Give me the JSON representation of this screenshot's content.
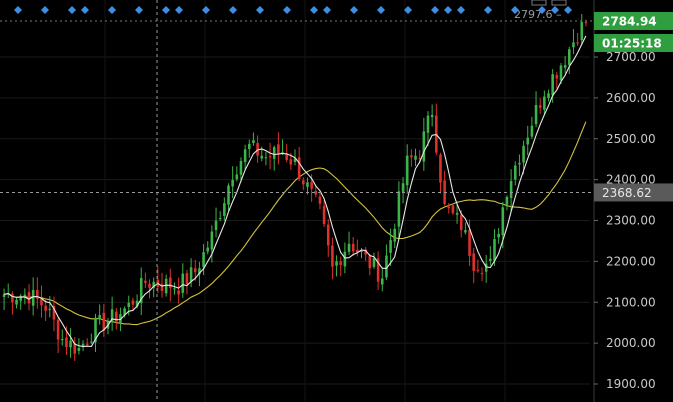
{
  "chart_data": {
    "type": "candlestick",
    "y_axis": {
      "ticks": [
        "1900.00",
        "2000.00",
        "2100.00",
        "2200.00",
        "2300.00",
        "2400.00",
        "2500.00",
        "2600.00",
        "2700.00"
      ],
      "range": [
        1855,
        2830
      ]
    },
    "price_tag": {
      "value": "2784.94",
      "color": "#2e9e3e"
    },
    "timer_tag": {
      "value": "01:25:18",
      "color": "#2e9e3e"
    },
    "cursor_tag": {
      "value": "2368.62",
      "color": "#5a5a5a"
    },
    "ref_line": {
      "label": "2797.6 –",
      "value": 2797.6
    },
    "colors": {
      "up": "#3bb54a",
      "down": "#e0302c",
      "ma_fast": "#e8e8e8",
      "ma_slow": "#d4c23a",
      "marker": "#3d8fe6",
      "grid": "#1a1a1a"
    },
    "candle_count": 141,
    "keypoints": [
      [
        0,
        2120
      ],
      [
        6,
        2118
      ],
      [
        10,
        2090
      ],
      [
        14,
        2010
      ],
      [
        18,
        1985
      ],
      [
        22,
        2040
      ],
      [
        26,
        2060
      ],
      [
        30,
        2090
      ],
      [
        34,
        2150
      ],
      [
        38,
        2145
      ],
      [
        42,
        2140
      ],
      [
        46,
        2175
      ],
      [
        50,
        2260
      ],
      [
        55,
        2420
      ],
      [
        59,
        2480
      ],
      [
        63,
        2455
      ],
      [
        67,
        2470
      ],
      [
        70,
        2440
      ],
      [
        73,
        2380
      ],
      [
        76,
        2320
      ],
      [
        79,
        2180
      ],
      [
        83,
        2250
      ],
      [
        87,
        2205
      ],
      [
        91,
        2165
      ],
      [
        94,
        2300
      ],
      [
        97,
        2440
      ],
      [
        100,
        2470
      ],
      [
        103,
        2570
      ],
      [
        106,
        2330
      ],
      [
        110,
        2290
      ],
      [
        113,
        2200
      ],
      [
        117,
        2190
      ],
      [
        121,
        2380
      ],
      [
        125,
        2490
      ],
      [
        130,
        2620
      ],
      [
        135,
        2700
      ],
      [
        138,
        2760
      ],
      [
        140,
        2785
      ]
    ],
    "marker_count": 33
  }
}
